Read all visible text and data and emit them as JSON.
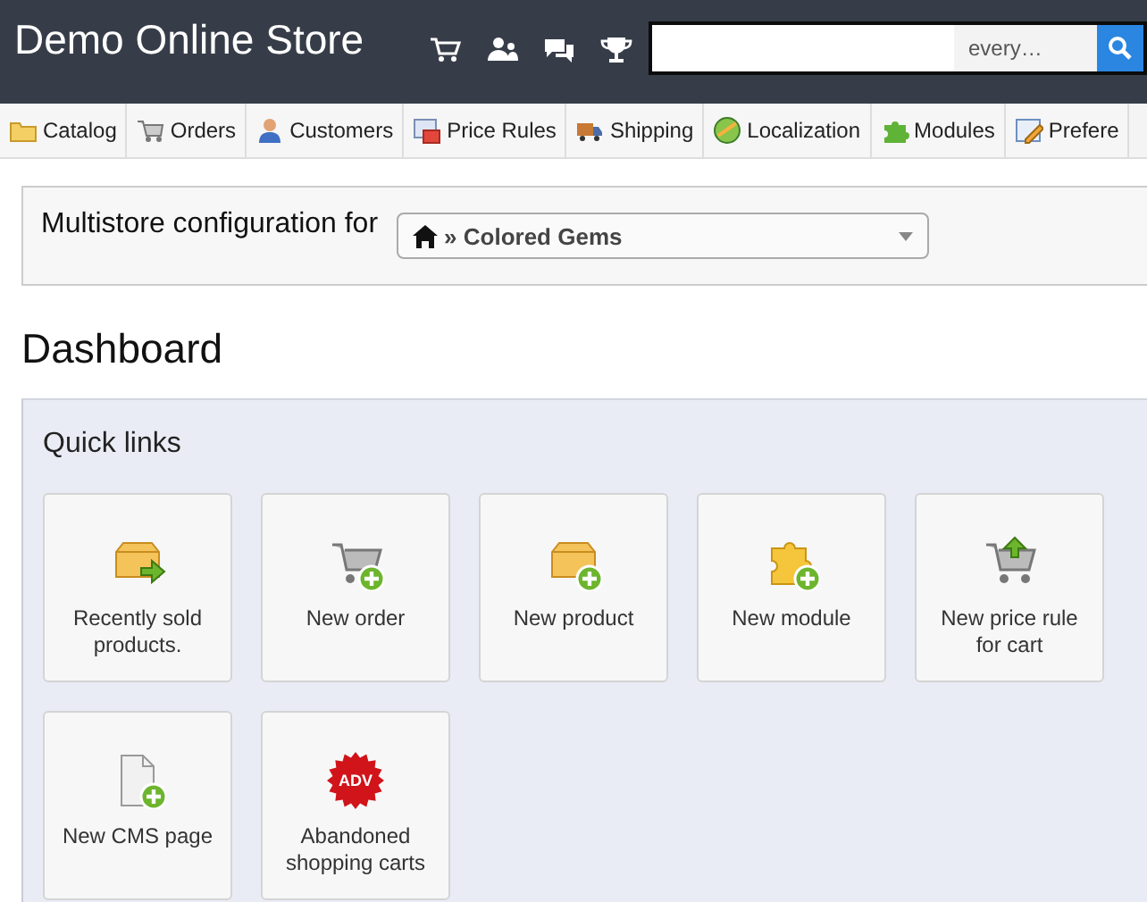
{
  "header": {
    "title": "Demo Online Store",
    "search": {
      "scope": "every…"
    }
  },
  "nav": [
    {
      "label": "Catalog"
    },
    {
      "label": "Orders"
    },
    {
      "label": "Customers"
    },
    {
      "label": "Price Rules"
    },
    {
      "label": "Shipping"
    },
    {
      "label": "Localization"
    },
    {
      "label": "Modules"
    },
    {
      "label": "Prefere"
    }
  ],
  "multistore": {
    "label": "Multistore configuration for",
    "value": "» Colored Gems"
  },
  "page_title": "Dashboard",
  "quick_links": {
    "title": "Quick links",
    "items": [
      {
        "label": "Recently sold products."
      },
      {
        "label": "New order"
      },
      {
        "label": "New product"
      },
      {
        "label": "New module"
      },
      {
        "label": "New price rule for cart"
      },
      {
        "label": "New CMS page"
      },
      {
        "label": "Abandoned shopping carts",
        "badge": "ADV"
      }
    ]
  }
}
